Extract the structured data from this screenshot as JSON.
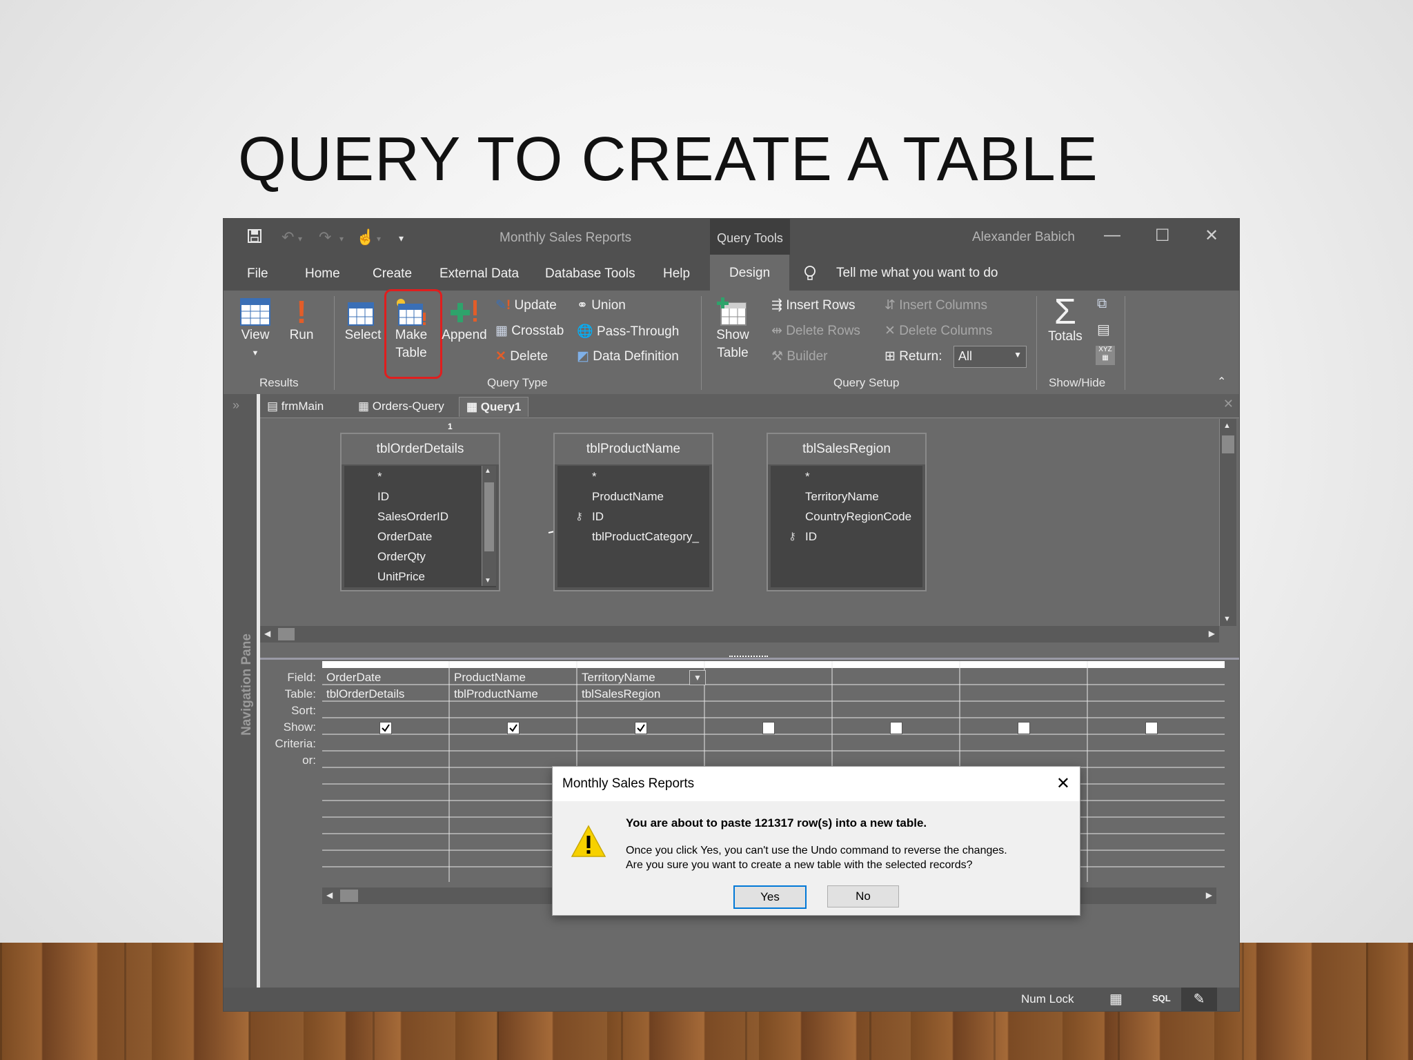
{
  "slide": {
    "title": "QUERY TO CREATE A TABLE"
  },
  "window": {
    "title": "Monthly Sales Reports",
    "context_tab": "Query Tools",
    "user": "Alexander Babich",
    "minimize": "—",
    "maximize": "☐",
    "close": "✕"
  },
  "menu": {
    "items": [
      "File",
      "Home",
      "Create",
      "External Data",
      "Database Tools",
      "Help",
      "Design"
    ],
    "active": "Design",
    "tell_me": "Tell me what you want to do"
  },
  "ribbon": {
    "results": {
      "view": "View",
      "run": "Run",
      "group": "Results"
    },
    "query_type": {
      "select": "Select",
      "make_table_1": "Make",
      "make_table_2": "Table",
      "append": "Append",
      "update": "Update",
      "crosstab": "Crosstab",
      "delete": "Delete",
      "union": "Union",
      "pass_through": "Pass-Through",
      "data_definition": "Data Definition",
      "group": "Query Type"
    },
    "query_setup": {
      "show_table_1": "Show",
      "show_table_2": "Table",
      "insert_rows": "Insert Rows",
      "delete_rows": "Delete Rows",
      "builder": "Builder",
      "insert_columns": "Insert Columns",
      "delete_columns": "Delete Columns",
      "return_label": "Return:",
      "return_value": "All",
      "group": "Query Setup"
    },
    "show_hide": {
      "totals": "Totals",
      "group": "Show/Hide"
    }
  },
  "nav_pane": {
    "label": "Navigation Pane"
  },
  "doc_tabs": [
    "frmMain",
    "Orders-Query",
    "Query1"
  ],
  "active_doc_tab": "Query1",
  "tables": [
    {
      "name": "tblOrderDetails",
      "fields": [
        "*",
        "ID",
        "SalesOrderID",
        "OrderDate",
        "OrderQty",
        "UnitPrice"
      ]
    },
    {
      "name": "tblProductName",
      "fields": [
        "*",
        "ProductName",
        "ID",
        "tblProductCategory_"
      ]
    },
    {
      "name": "tblSalesRegion",
      "fields": [
        "*",
        "TerritoryName",
        "CountryRegionCode",
        "ID"
      ]
    }
  ],
  "relationships": {
    "one": "1",
    "many": "∞"
  },
  "grid": {
    "row_labels": [
      "Field:",
      "Table:",
      "Sort:",
      "Show:",
      "Criteria:",
      "or:"
    ],
    "columns": [
      {
        "field": "OrderDate",
        "table": "tblOrderDetails",
        "show": true
      },
      {
        "field": "ProductName",
        "table": "tblProductName",
        "show": true
      },
      {
        "field": "TerritoryName",
        "table": "tblSalesRegion",
        "show": true
      },
      {
        "field": "",
        "table": "",
        "show": false
      },
      {
        "field": "",
        "table": "",
        "show": false
      },
      {
        "field": "",
        "table": "",
        "show": false
      },
      {
        "field": "",
        "table": "",
        "show": false
      }
    ]
  },
  "status": {
    "num_lock": "Num Lock",
    "sql": "SQL"
  },
  "dialog": {
    "title": "Monthly Sales Reports",
    "message_bold": "You are about to paste 121317 row(s) into a new table.",
    "message_1": "Once you click Yes, you can't use the Undo command to reverse the changes.",
    "message_2": "Are you sure you want to create a new table with the selected records?",
    "yes": "Yes",
    "no": "No"
  },
  "colors": {
    "highlight": "#e01e1e",
    "warning": "#f7d100",
    "key": "#d0d0d0"
  }
}
